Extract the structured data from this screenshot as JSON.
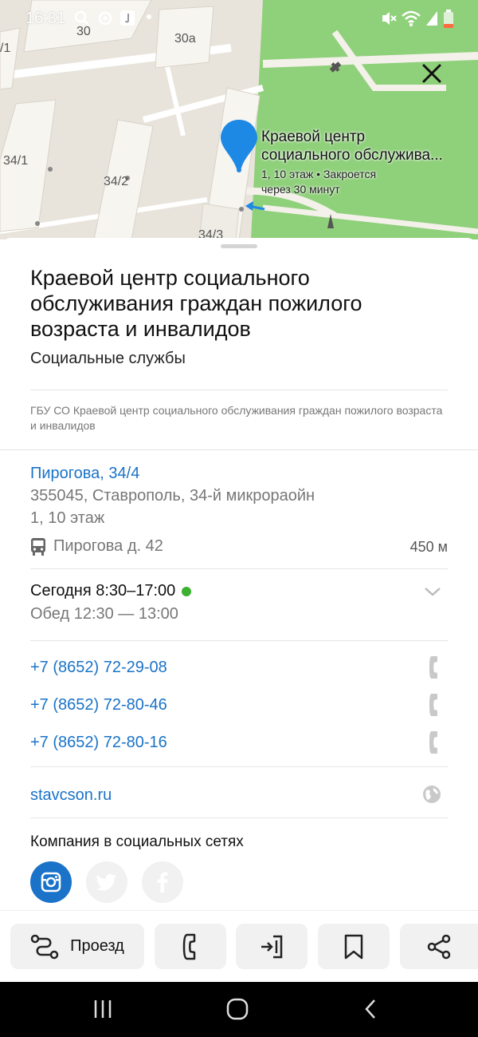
{
  "status_bar": {
    "time": "16:31"
  },
  "map": {
    "building_labels": [
      "30",
      "30а",
      "/1",
      "34/1",
      "34/2",
      "34/3"
    ],
    "pin": {
      "title": "Краевой центр\nсоциального обслужива...",
      "subtitle": "1, 10 этаж • Закроется\nчерез 30 минут",
      "color": "#1e88e5"
    },
    "park_color": "#8fd07a"
  },
  "place": {
    "title": "Краевой центр социального обслуживания граждан пожилого возраста и инвалидов",
    "category": "Социальные службы",
    "legal_name": "ГБУ СО Краевой центр социального обслуживания граждан пожилого возраста и инвалидов",
    "address": {
      "street": "Пирогова, 34/4",
      "city": "355045, Ставрополь, 34-й микрораойн",
      "floor": "1, 10 этаж"
    },
    "transit": {
      "stop": "Пирогова д. 42",
      "distance": "450 м",
      "icon": "bus-icon"
    },
    "hours": {
      "today": "Сегодня 8:30–17:00",
      "lunch": "Обед 12:30 — 13:00",
      "status_color": "#3cb02f"
    },
    "phones": [
      "+7 (8652) 72-29-08",
      "+7 (8652) 72-80-46",
      "+7 (8652) 72-80-16"
    ],
    "website": "stavcson.ru",
    "social": {
      "title": "Компания в социальных сетях",
      "networks": [
        "instagram",
        "twitter",
        "facebook"
      ],
      "active_color": "#1a73c8"
    }
  },
  "actions": {
    "route_label": "Проезд",
    "buttons": [
      "route-icon",
      "phone-icon",
      "entrance-icon",
      "bookmark-icon",
      "share-icon"
    ]
  },
  "colors": {
    "link": "#1a73c8",
    "secondary_text": "#777777"
  }
}
